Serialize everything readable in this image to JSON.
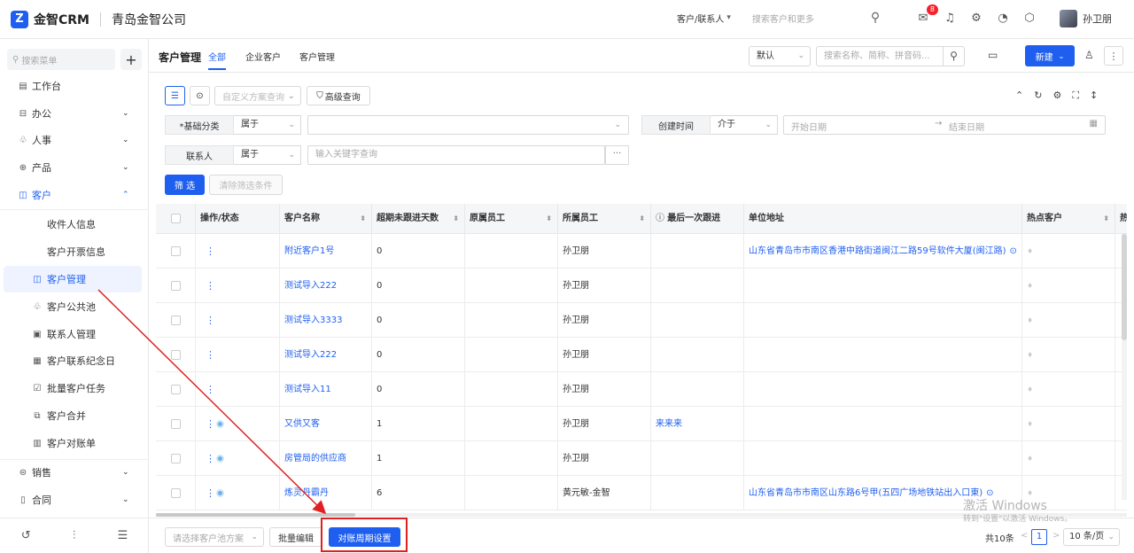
{
  "header": {
    "logo_text": "金智CRM",
    "logo_mark": "Z",
    "company": "青岛金智公司",
    "search_scope": "客户/联系人",
    "search_placeholder": "搜索客户和更多",
    "notification_count": "8",
    "user_name": "孙卫朋"
  },
  "sidebar": {
    "search_placeholder": "搜索菜单",
    "add_label": "+",
    "items": [
      {
        "label": "工作台",
        "icon": "workbench-icon",
        "glyph": "▤"
      },
      {
        "label": "办公",
        "icon": "office-icon",
        "glyph": "⊟",
        "caret": "⌄"
      },
      {
        "label": "人事",
        "icon": "hr-icon",
        "glyph": "♧",
        "caret": "⌄"
      },
      {
        "label": "产品",
        "icon": "product-icon",
        "glyph": "⊕",
        "caret": "⌄"
      },
      {
        "label": "客户",
        "icon": "customer-icon",
        "glyph": "◫",
        "caret": "⌃"
      }
    ],
    "sub_items": [
      {
        "label": "收件人信息",
        "icon": ""
      },
      {
        "label": "客户开票信息",
        "icon": ""
      },
      {
        "label": "客户管理",
        "icon": "customer-manage-icon",
        "glyph": "◫"
      },
      {
        "label": "客户公共池",
        "icon": "public-pool-icon",
        "glyph": "♧"
      },
      {
        "label": "联系人管理",
        "icon": "contact-icon",
        "glyph": "▣"
      },
      {
        "label": "客户联系纪念日",
        "icon": "anniversary-icon",
        "glyph": "▦"
      },
      {
        "label": "批量客户任务",
        "icon": "task-icon",
        "glyph": "☑"
      },
      {
        "label": "客户合并",
        "icon": "merge-icon",
        "glyph": "⧉"
      },
      {
        "label": "客户对账单",
        "icon": "statement-icon",
        "glyph": "▥"
      }
    ],
    "bottom_items": [
      {
        "label": "销售",
        "icon": "sales-icon",
        "glyph": "⊜",
        "caret": "⌄"
      },
      {
        "label": "合同",
        "icon": "contract-icon",
        "glyph": "▯",
        "caret": "⌄"
      }
    ],
    "footer_icons": [
      "history-icon",
      "settings-sliders-icon",
      "collapse-menu-icon"
    ]
  },
  "main": {
    "title": "客户管理",
    "tabs": [
      {
        "label": "全部",
        "active": true
      },
      {
        "label": "企业客户",
        "active": false
      },
      {
        "label": "客户管理",
        "active": false
      }
    ],
    "sort_select": "默认",
    "search_placeholder": "搜索名称、简称、拼音码...",
    "new_button": "新建"
  },
  "filters": {
    "scheme_placeholder": "自定义方案查询",
    "advanced": "高级查询",
    "row1": {
      "label": "*基础分类",
      "op": "属于",
      "value": ""
    },
    "created": {
      "label": "创建时间",
      "op": "介于",
      "start": "开始日期",
      "end": "结束日期"
    },
    "row2": {
      "label": "联系人",
      "op": "属于",
      "placeholder": "输入关键字查询"
    },
    "filter_button": "筛 选",
    "clear_button": "清除筛选条件"
  },
  "table": {
    "columns": [
      "操作/状态",
      "客户名称",
      "超期未跟进天数",
      "原属员工",
      "所属员工",
      "最后一次跟进",
      "单位地址",
      "热点客户",
      "热"
    ],
    "rows": [
      {
        "name": "附近客户1号",
        "days": "0",
        "owner": "孙卫朋",
        "last": "",
        "address": "山东省青岛市市南区香港中路街道闽江二路59号软件大厦(闽江路)",
        "status": false,
        "pin": true
      },
      {
        "name": "测试导入222",
        "days": "0",
        "owner": "孙卫朋",
        "last": "",
        "address": "",
        "status": false,
        "pin": false
      },
      {
        "name": "测试导入3333",
        "days": "0",
        "owner": "孙卫朋",
        "last": "",
        "address": "",
        "status": false,
        "pin": false
      },
      {
        "name": "测试导入222",
        "days": "0",
        "owner": "孙卫朋",
        "last": "",
        "address": "",
        "status": false,
        "pin": false
      },
      {
        "name": "测试导入11",
        "days": "0",
        "owner": "孙卫朋",
        "last": "",
        "address": "",
        "status": false,
        "pin": false
      },
      {
        "name": "又供又客",
        "days": "1",
        "owner": "孙卫朋",
        "last": "来来来",
        "address": "",
        "status": true,
        "pin": false
      },
      {
        "name": "房管局的供应商",
        "days": "1",
        "owner": "孙卫朋",
        "last": "",
        "address": "",
        "status": true,
        "pin": false
      },
      {
        "name": "炼灵丹霸丹",
        "days": "6",
        "owner": "黄元敏-金智",
        "last": "",
        "address": "山东省青岛市市南区山东路6号甲(五四广场地铁站出入口東)",
        "status": true,
        "pin": true
      }
    ]
  },
  "footer": {
    "pool_placeholder": "请选择客户池方案",
    "batch_edit": "批量编辑",
    "period_setting": "对账周期设置",
    "total": "共10条",
    "page": "1",
    "page_size": "10 条/页",
    "prev": "<",
    "next": ">"
  },
  "watermark": {
    "line1": "激活 Windows",
    "line2": "转到\"设置\"以激活 Windows。"
  },
  "colors": {
    "accent": "#1f5ff0",
    "highlight": "#e02020"
  }
}
